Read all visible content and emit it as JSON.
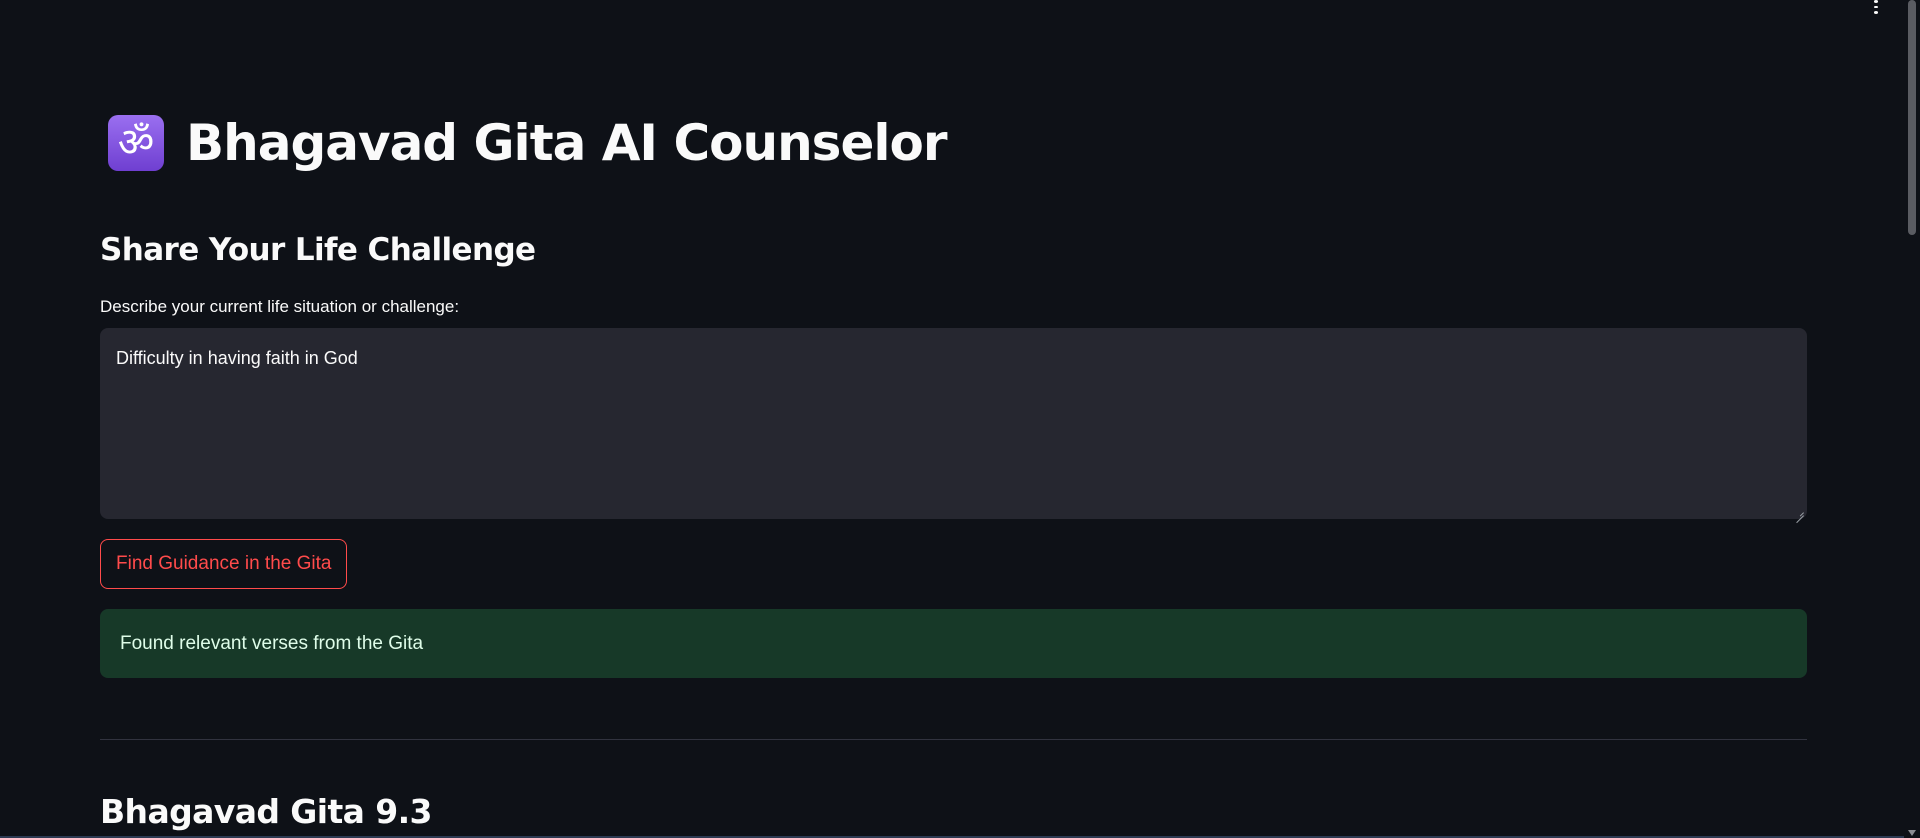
{
  "app": {
    "title": "Bhagavad Gita AI Counselor",
    "title_icon": "om-icon",
    "icon_glyph": "ॐ"
  },
  "form": {
    "section_heading": "Share Your Life Challenge",
    "field_label": "Describe your current life situation or challenge:",
    "field_value": "Difficulty in having faith in God",
    "submit_label": "Find Guidance in the Gita"
  },
  "status": {
    "success_message": "Found relevant verses from the Gita"
  },
  "results": {
    "verse_heading": "Bhagavad Gita 9.3"
  },
  "colors": {
    "background": "#0e1117",
    "input_background": "#262730",
    "accent": "#ff4b4b",
    "success_background": "#173928",
    "text": "#fafafa"
  }
}
